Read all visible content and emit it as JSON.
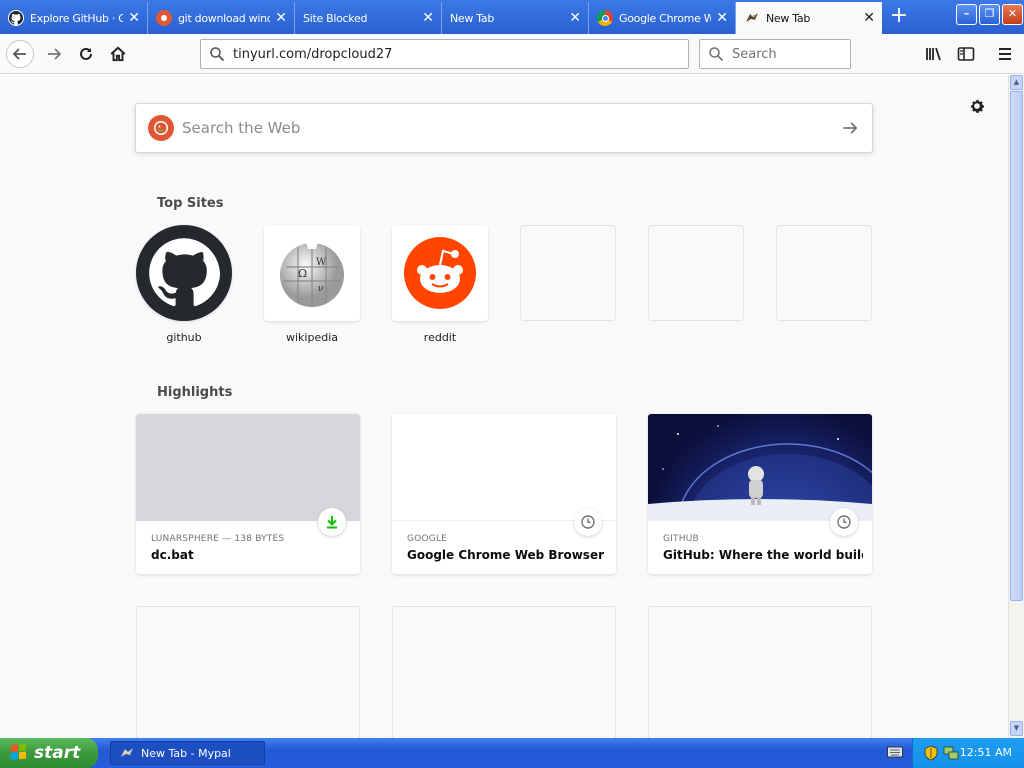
{
  "tabs": [
    {
      "title": "Explore GitHub · GitHub",
      "icon": "github-favicon"
    },
    {
      "title": "git download windows",
      "icon": "duckduckgo-favicon"
    },
    {
      "title": "Site Blocked",
      "icon": ""
    },
    {
      "title": "New Tab",
      "icon": ""
    },
    {
      "title": "Google Chrome Web Browser",
      "icon": "chrome-favicon"
    },
    {
      "title": "New Tab",
      "icon": "dragon-favicon"
    }
  ],
  "navbar": {
    "url": "tinyurl.com/dropcloud27",
    "search_placeholder": "Search"
  },
  "websearch": {
    "placeholder": "Search the Web"
  },
  "top_sites": {
    "title": "Top Sites",
    "items": [
      {
        "label": "github",
        "icon": "github-logo"
      },
      {
        "label": "wikipedia",
        "icon": "wikipedia-logo"
      },
      {
        "label": "reddit",
        "icon": "reddit-logo"
      }
    ]
  },
  "highlights": {
    "title": "Highlights",
    "items": [
      {
        "context": "LUNARSPHERE — 138 BYTES",
        "title": "dc.bat",
        "badge": "download-icon"
      },
      {
        "context": "GOOGLE",
        "title": "Google Chrome Web Browser",
        "badge": "clock-icon"
      },
      {
        "context": "GITHUB",
        "title": "GitHub: Where the world builds ...",
        "badge": "clock-icon"
      }
    ]
  },
  "taskbar": {
    "start_label": "start",
    "task_label": "New Tab - Mypal",
    "clock": "12:51 AM"
  },
  "colors": {
    "titlebar_blue": "#2a5fd0",
    "reddit_orange": "#ff4500",
    "download_green": "#12bc00",
    "duckduckgo_orange": "#de5833"
  }
}
